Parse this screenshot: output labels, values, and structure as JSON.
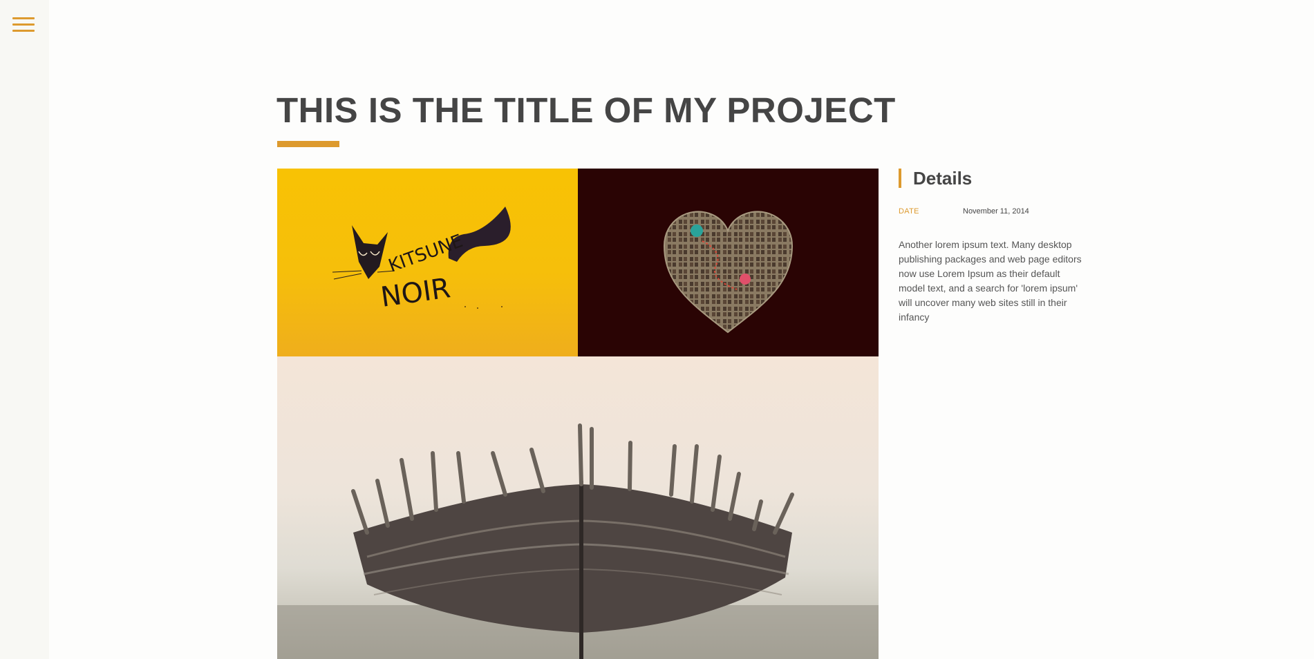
{
  "app": {
    "title": "THIS IS THE TITLE OF MY PROJECT",
    "accent_color": "#dd9a2e",
    "text_color": "#454545"
  },
  "sidebar": {
    "menu_icon": "hamburger-menu-icon"
  },
  "gallery": {
    "images": [
      {
        "name": "kitsune-noir-illustration",
        "text_line1": "KITSUNE",
        "text_line2": "NOIR"
      },
      {
        "name": "heart-of-windows-illustration"
      },
      {
        "name": "old-wooden-boat-photo"
      }
    ]
  },
  "details": {
    "heading": "Details",
    "date_label": "DATE",
    "date_value": "November 11, 2014",
    "description": "Another lorem ipsum text. Many desktop publishing packages and web page editors now use Lorem Ipsum as their default model text, and a search for 'lorem ipsum' will uncover many web sites still in their infancy"
  }
}
